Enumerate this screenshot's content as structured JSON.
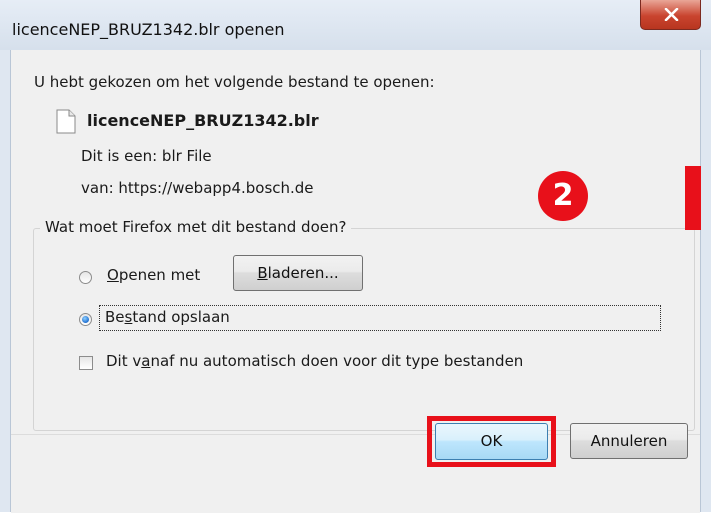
{
  "window": {
    "title": "licenceNEP_BRUZ1342.blr openen",
    "close_label": "X"
  },
  "dialog": {
    "intro": "U hebt gekozen om het volgende bestand te openen:",
    "file_name": "licenceNEP_BRUZ1342.blr",
    "type_label": "Dit is een:",
    "type_value": "blr File",
    "from_label": "van:",
    "from_value": "https://webapp4.bosch.de",
    "question": "Wat moet Firefox met dit bestand doen?",
    "open_with_label": "Openen met",
    "open_with_accesskey": "O",
    "open_with_rest": "penen met",
    "browse_label": "Bladeren...",
    "browse_accesskey": "B",
    "browse_rest": "laderen...",
    "save_label": "Bestand opslaan",
    "save_prefix": "Be",
    "save_accesskey": "s",
    "save_rest": "tand opslaan",
    "save_selected": true,
    "auto_label": "Dit vanaf nu automatisch doen voor dit type bestanden",
    "auto_prefix": "Dit v",
    "auto_accesskey": "a",
    "auto_rest": "naf nu automatisch doen voor dit type bestanden",
    "auto_checked": false,
    "ok_label": "OK",
    "cancel_label": "Annuleren"
  },
  "annotation": {
    "step_number": "2",
    "highlight_color": "#e8101a"
  },
  "icons": {
    "close": "close-icon",
    "file": "file-icon",
    "radio": "radio-button",
    "checkbox": "checkbox"
  }
}
